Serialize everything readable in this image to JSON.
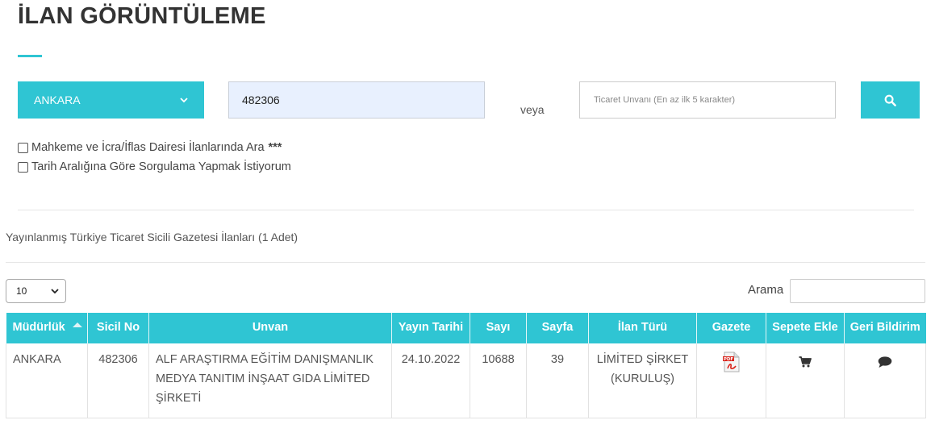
{
  "page": {
    "title": "İLAN GÖRÜNTÜLEME"
  },
  "search": {
    "city_value": "ANKARA",
    "sicil_value": "482306",
    "or_label": "veya",
    "unvan_placeholder": "Ticaret Unvanı (En az ilk 5 karakter)",
    "search_icon": "search-icon"
  },
  "options": {
    "court_label": "Mahkeme ve İcra/İflas Dairesi İlanlarında Ara",
    "court_stars": "***",
    "date_label": "Tarih Aralığına Göre Sorgulama Yapmak İstiyorum"
  },
  "results": {
    "summary": "Yayınlanmış Türkiye Ticaret Sicili Gazetesi İlanları (1 Adet)",
    "page_length": "10",
    "search_label": "Arama",
    "columns": {
      "mudurluk": "Müdürlük",
      "sicil_no": "Sicil No",
      "unvan": "Unvan",
      "yayin_tarihi": "Yayın Tarihi",
      "sayi": "Sayı",
      "sayfa": "Sayfa",
      "ilan_turu": "İlan Türü",
      "gazete": "Gazete",
      "sepete_ekle": "Sepete Ekle",
      "geri_bildirim": "Geri Bildirim"
    },
    "rows": [
      {
        "mudurluk": "ANKARA",
        "sicil_no": "482306",
        "unvan": "ALF ARAŞTIRMA EĞİTİM DANIŞMANLIK MEDYA TANITIM İNŞAAT GIDA LİMİTED ŞİRKETİ",
        "yayin_tarihi": "24.10.2022",
        "sayi": "10688",
        "sayfa": "39",
        "ilan_turu": "LİMİTED ŞİRKET (KURULUŞ)",
        "gazete_icon": "pdf-icon",
        "cart_icon": "cart-icon",
        "feedback_icon": "comment-icon"
      }
    ]
  },
  "colors": {
    "accent": "#2fc5d3",
    "input_highlight": "#e8f0fe"
  }
}
